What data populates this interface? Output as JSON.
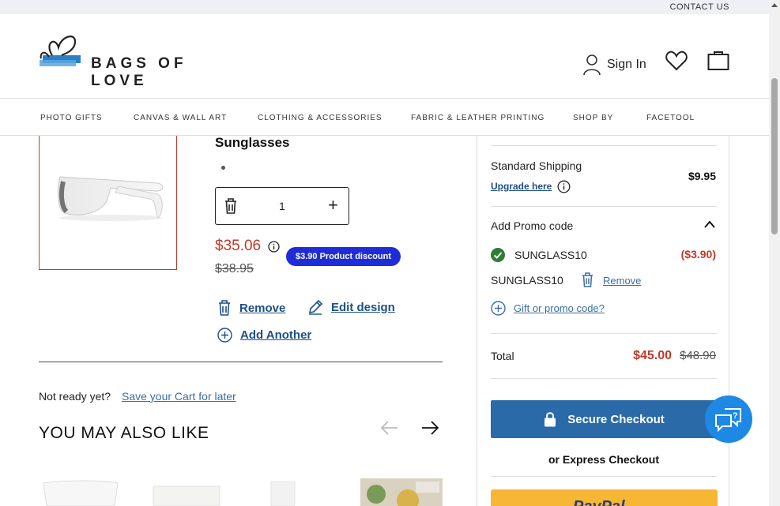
{
  "topbar": {
    "contact": "CONTACT US"
  },
  "header": {
    "logo_text": "BAGS OF LOVE",
    "signin_label": "Sign In"
  },
  "nav": {
    "items": [
      "PHOTO GIFTS",
      "CANVAS & WALL ART",
      "CLOTHING & ACCESSORIES",
      "FABRIC & LEATHER PRINTING",
      "SHOP BY",
      "FACETOOL"
    ]
  },
  "cart_item": {
    "title": "Sunglasses",
    "quantity": "1",
    "price": "$35.06",
    "old_price": "$38.95",
    "discount_badge": "$3.90 Product discount",
    "remove_label": "Remove",
    "edit_label": "Edit design",
    "add_another_label": "Add Another"
  },
  "save": {
    "not_ready": "Not ready yet?",
    "save_link": "Save your Cart for later"
  },
  "recommendations": {
    "heading": "YOU MAY ALSO LIKE"
  },
  "summary": {
    "shipping_label": "Standard Shipping",
    "upgrade_label": "Upgrade here",
    "shipping_price": "$9.95",
    "promo_heading": "Add Promo code",
    "promo_applied_code": "SUNGLASS10",
    "promo_amount": "($3.90)",
    "promo_code_line": "SUNGLASS10",
    "promo_remove": "Remove",
    "gift_label": "Gift or promo code?",
    "total_label": "Total",
    "total_value": "$45.00",
    "total_old": "$48.90",
    "checkout_label": "Secure Checkout",
    "express_label": "or Express Checkout",
    "paypal_label": "PayPal"
  },
  "colors": {
    "accent_blue": "#2b6aa8",
    "price_red": "#c0392b",
    "badge_blue": "#1f2dd8",
    "paypal_yellow": "#f7b634",
    "chat_blue": "#1e88e5"
  }
}
